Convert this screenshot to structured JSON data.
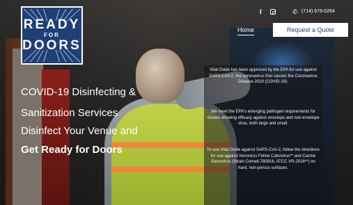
{
  "logo": {
    "line1": "READY",
    "line2": "FOR",
    "line3": "DOORS"
  },
  "topbar": {
    "facebook_icon": "facebook-icon",
    "instagram_icon": "instagram-icon",
    "phone_icon": "phone-icon",
    "phone": "(714) 676-0264"
  },
  "nav": {
    "home": "Home",
    "quote": "Request a Quote"
  },
  "hero": {
    "line1": "COVID-19 Disinfecting &",
    "line2": "Sanitization Services",
    "line3": "Disinfect Your Venue and",
    "line4": "Get Ready for Doors"
  },
  "info": {
    "p1": "Vital Oxide has been approved by the EPA for use against SARS-CoV-2, the coronavirus that causes the Coronavirus Disease 2019 (COVID-19).",
    "p2": "We meet the EPA's emerging pathogen requirements for viruses showing efficacy against envelope and non-envelope virus, both large and small.",
    "p3": "To use Vital Oxide against SARS-CoV-2, follow the directions for use against Norovirus Feline Calicivirus** and Canine Parvovirus (Strain Cornell-780916, ATCC VR-2016**) on hard, non-porous surfaces."
  },
  "colors": {
    "brand_blue": "#1f3f77",
    "vest_yellow": "#c4d640",
    "white": "#ffffff"
  }
}
